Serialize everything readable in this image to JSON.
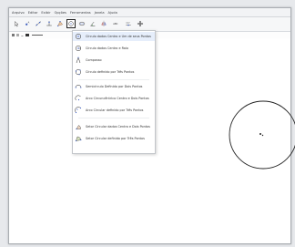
{
  "menubar": {
    "items": [
      "Arquivo",
      "Editar",
      "Exibir",
      "Opções",
      "Ferramentas",
      "Janela",
      "Ajuda"
    ]
  },
  "toolbar": {
    "tools": [
      {
        "name": "move-tool-icon"
      },
      {
        "name": "point-tool-icon"
      },
      {
        "name": "line-tool-icon"
      },
      {
        "name": "perpendicular-tool-icon"
      },
      {
        "name": "polygon-tool-icon"
      },
      {
        "name": "circle-tool-icon",
        "active": true
      },
      {
        "name": "ellipse-tool-icon"
      },
      {
        "name": "angle-tool-icon"
      },
      {
        "name": "reflect-tool-icon"
      },
      {
        "name": "slider-tool-icon",
        "text": "ABC"
      },
      {
        "name": "slider-input-icon",
        "text": "a=2"
      },
      {
        "name": "move-view-icon"
      }
    ]
  },
  "circle_menu": {
    "items": [
      {
        "label": "Círculo dados Centro e Um de seus Pontos",
        "icon": "circle-center-point-icon"
      },
      {
        "label": "Círculo dados Centro e Raio",
        "icon": "circle-center-radius-icon"
      },
      {
        "label": "Compasso",
        "icon": "compass-icon"
      },
      {
        "label": "Círculo definido por Três Pontos",
        "icon": "circle-three-points-icon"
      },
      {
        "label": "Semicírculo Definido por Dois Pontos",
        "icon": "semicircle-icon"
      },
      {
        "label": "Arco Circuncêntrico Centro e Dois Pontos",
        "icon": "circumcircular-arc-icon"
      },
      {
        "label": "Arco Circular definido por Três Pontos",
        "icon": "circular-arc-three-points-icon"
      },
      {
        "label": "Setor Circular dados Centro e Dois Pontos",
        "icon": "circular-sector-icon"
      },
      {
        "label": "Setor Circular definido por Três Pontos",
        "icon": "circumcircular-sector-icon"
      }
    ]
  },
  "colors": {
    "selection": "#e6eefb",
    "circle_stroke": "#222222"
  }
}
